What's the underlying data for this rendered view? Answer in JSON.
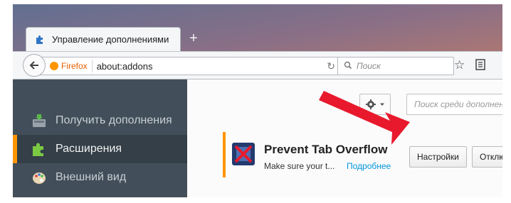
{
  "tab": {
    "title": "Управление дополнениями",
    "new_tab": "+"
  },
  "navbar": {
    "identity_label": "Firefox",
    "url": "about:addons",
    "search_placeholder": "Поиск"
  },
  "sidebar": {
    "items": [
      {
        "label": "Получить дополнения",
        "icon": "get-addons-icon",
        "selected": false
      },
      {
        "label": "Расширения",
        "icon": "puzzle-piece-icon",
        "selected": true
      },
      {
        "label": "Внешний вид",
        "icon": "palette-icon",
        "selected": false
      }
    ]
  },
  "toolbar": {
    "search_placeholder": "Поиск среди дополнений"
  },
  "addon": {
    "name": "Prevent Tab Overflow",
    "description": "Make sure your t...",
    "more_link": "Подробнее",
    "settings_button": "Настройки",
    "disable_button": "Отключить"
  },
  "colors": {
    "sidebar_bg": "#424f5a",
    "accent_orange": "#ff9500",
    "link_blue": "#0095dd",
    "annotation_red": "#e8192c"
  }
}
